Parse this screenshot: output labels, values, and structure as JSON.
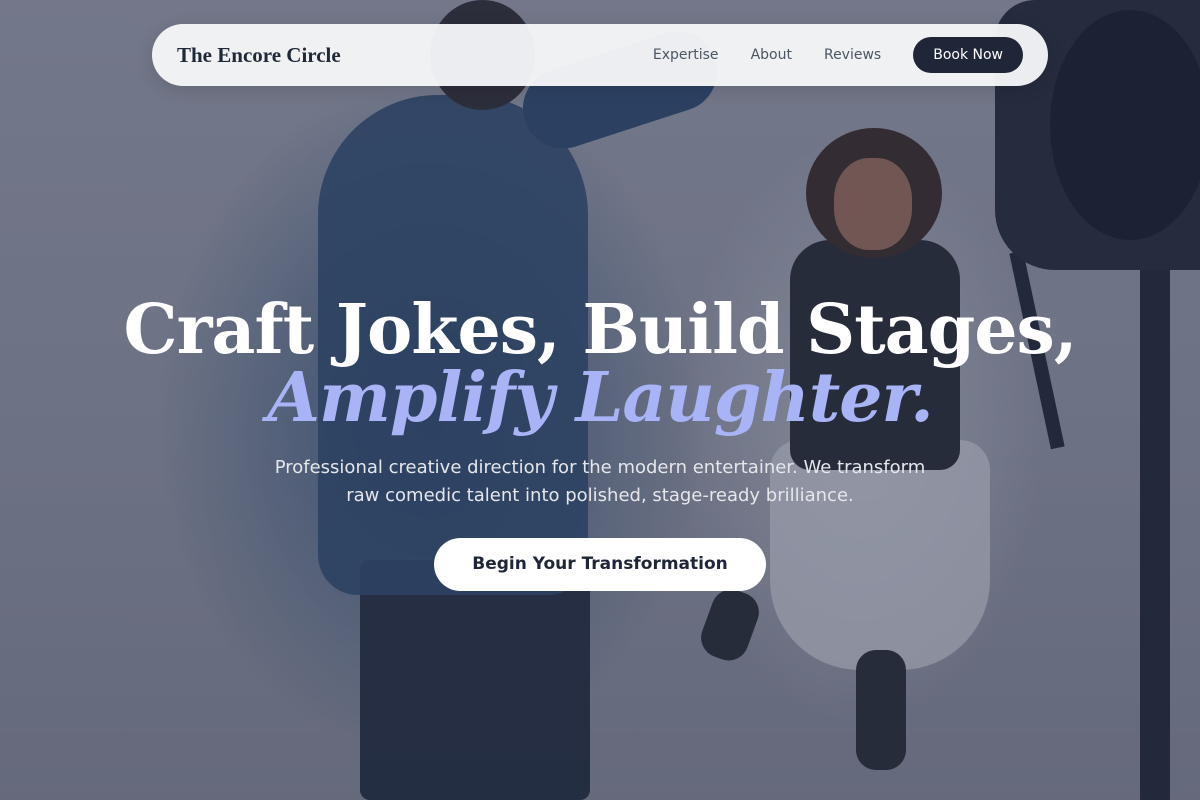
{
  "nav": {
    "brand": "The Encore Circle",
    "links": [
      {
        "label": "Expertise"
      },
      {
        "label": "About"
      },
      {
        "label": "Reviews"
      }
    ],
    "cta_label": "Book Now"
  },
  "hero": {
    "headline_line1": "Craft Jokes, Build Stages,",
    "headline_line2": "Amplify Laughter.",
    "subtext": "Professional creative direction for the modern entertainer. We transform raw comedic talent into polished, stage-ready brilliance.",
    "cta_label": "Begin Your Transformation"
  },
  "colors": {
    "accent": "#a9b4f7",
    "dark": "#1e2638",
    "nav_bg": "#f5f6f8"
  }
}
